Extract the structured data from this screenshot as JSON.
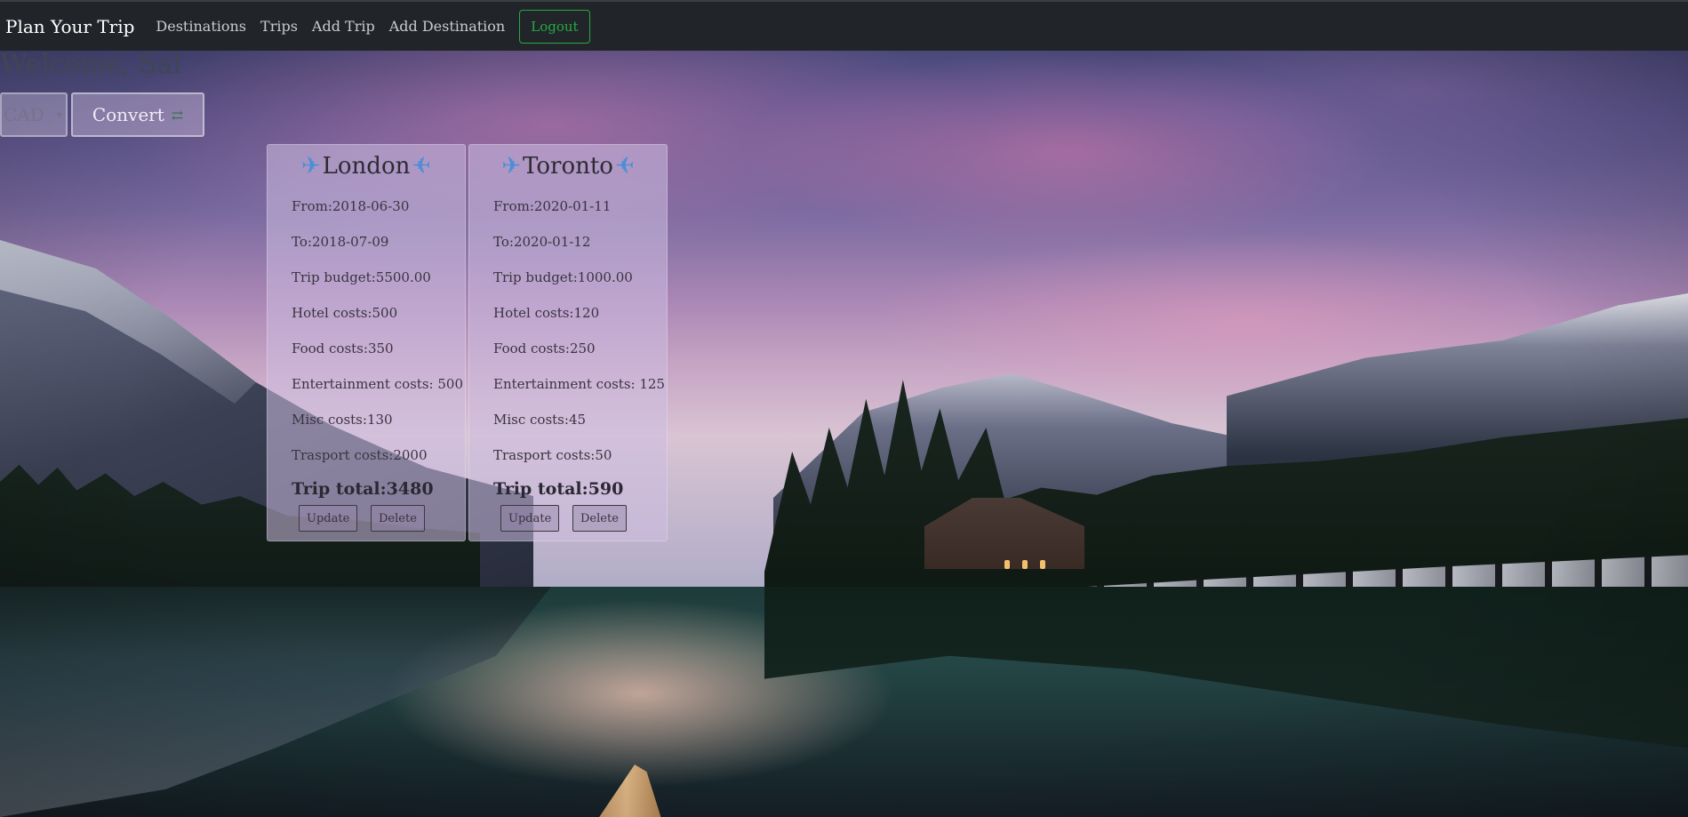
{
  "navbar": {
    "brand": "Plan Your Trip",
    "links": [
      "Destinations",
      "Trips",
      "Add Trip",
      "Add Destination"
    ],
    "logout": "Logout",
    "logout_color": "#28a745"
  },
  "welcome": "Welcome, Sal",
  "converter": {
    "currency": "CAD",
    "convert_label": "Convert",
    "convert_icon": "swap-icon"
  },
  "labels": {
    "from": "From:",
    "to": "To:",
    "budget": "Trip budget:",
    "hotel": "Hotel costs:",
    "food": "Food costs:",
    "entertainment": "Entertainment costs: ",
    "misc": "Misc costs:",
    "transport": "Trasport costs:",
    "total": "Trip total:",
    "update": "Update",
    "delete": "Delete"
  },
  "trips": [
    {
      "name": "London",
      "from": "2018-06-30",
      "to": "2018-07-09",
      "budget": "5500.00",
      "hotel": "500",
      "food": "350",
      "entertainment": "500",
      "misc": "130",
      "transport": "2000",
      "total": "3480"
    },
    {
      "name": "Toronto",
      "from": "2020-01-11",
      "to": "2020-01-12",
      "budget": "1000.00",
      "hotel": "120",
      "food": "250",
      "entertainment": "125",
      "misc": "45",
      "transport": "50",
      "total": "590"
    }
  ],
  "icons": {
    "title_icon": "airplane-icon"
  }
}
